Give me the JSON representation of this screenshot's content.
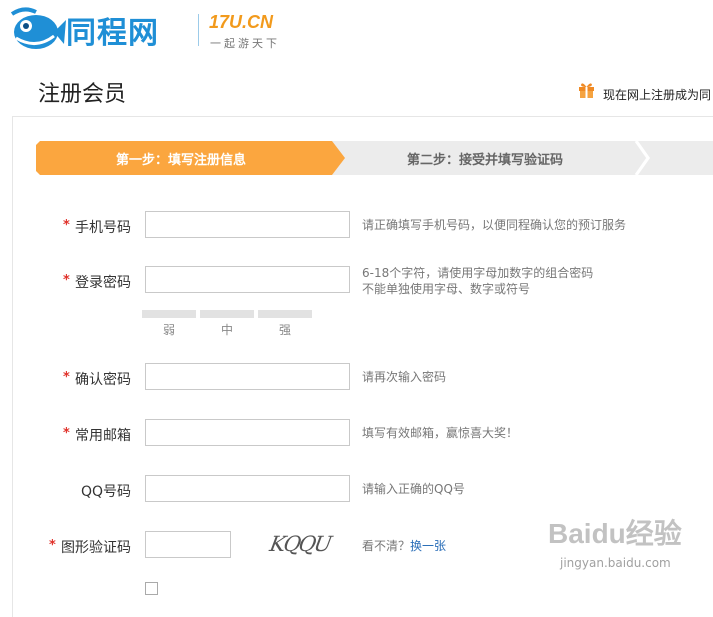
{
  "header": {
    "logo_text": "同程网",
    "logo_domain": "17U.CN",
    "logo_slogan": "一起游天下"
  },
  "page": {
    "title": "注册会员",
    "promo_text": "现在网上注册成为同",
    "promo_icon": "gift-icon"
  },
  "steps": [
    {
      "label": "第一步：填写注册信息",
      "active": true
    },
    {
      "label": "第二步：接受并填写验证码",
      "active": false
    }
  ],
  "colors": {
    "brand_blue": "#1f8fd6",
    "accent_orange": "#fba63f",
    "required_red": "#e0312a",
    "link_blue": "#2a6eb8"
  },
  "form": {
    "phone": {
      "label": "手机号码",
      "required": true,
      "value": "",
      "hint": "请正确填写手机号码，以便同程确认您的预订服务"
    },
    "password": {
      "label": "登录密码",
      "required": true,
      "value": "",
      "hint_line1": "6-18个字符，请使用字母加数字的组合密码",
      "hint_line2": "不能单独使用字母、数字或符号",
      "strength": [
        "弱",
        "中",
        "强"
      ]
    },
    "confirm_password": {
      "label": "确认密码",
      "required": true,
      "value": "",
      "hint": "请再次输入密码"
    },
    "email": {
      "label": "常用邮箱",
      "required": true,
      "value": "",
      "hint": "填写有效邮箱，赢惊喜大奖！"
    },
    "qq": {
      "label": "QQ号码",
      "required": false,
      "value": "",
      "hint": "请输入正确的QQ号"
    },
    "captcha": {
      "label": "图形验证码",
      "required": true,
      "value": "",
      "image_text": "KQQU",
      "hint": "看不清？",
      "refresh_link": "换一张"
    }
  },
  "required_mark": "*",
  "watermark": {
    "brand": "Baidu经验",
    "url": "jingyan.baidu.com"
  }
}
